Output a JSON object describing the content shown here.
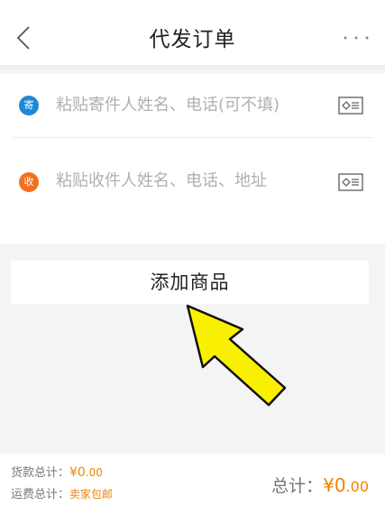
{
  "header": {
    "title": "代发订单"
  },
  "sender": {
    "badge": "寄",
    "badge_color": "#1e88d6",
    "placeholder": "粘贴寄件人姓名、电话(可不填)"
  },
  "receiver": {
    "badge": "收",
    "badge_color": "#f37021",
    "placeholder": "粘贴收件人姓名、电话、地址"
  },
  "add_goods": {
    "label": "添加商品"
  },
  "annotation": {
    "arrow_color": "#f8f000"
  },
  "footer": {
    "goods_total_label": "货款总计：",
    "goods_total_value": "¥0",
    "goods_total_decimals": ".00",
    "shipping_label": "运费总计：",
    "shipping_value": "卖家包邮",
    "total_label": "总计：",
    "total_value": "¥0",
    "total_decimals": ".00"
  },
  "colors": {
    "accent": "#f08300",
    "background": "#f4f4f4"
  }
}
